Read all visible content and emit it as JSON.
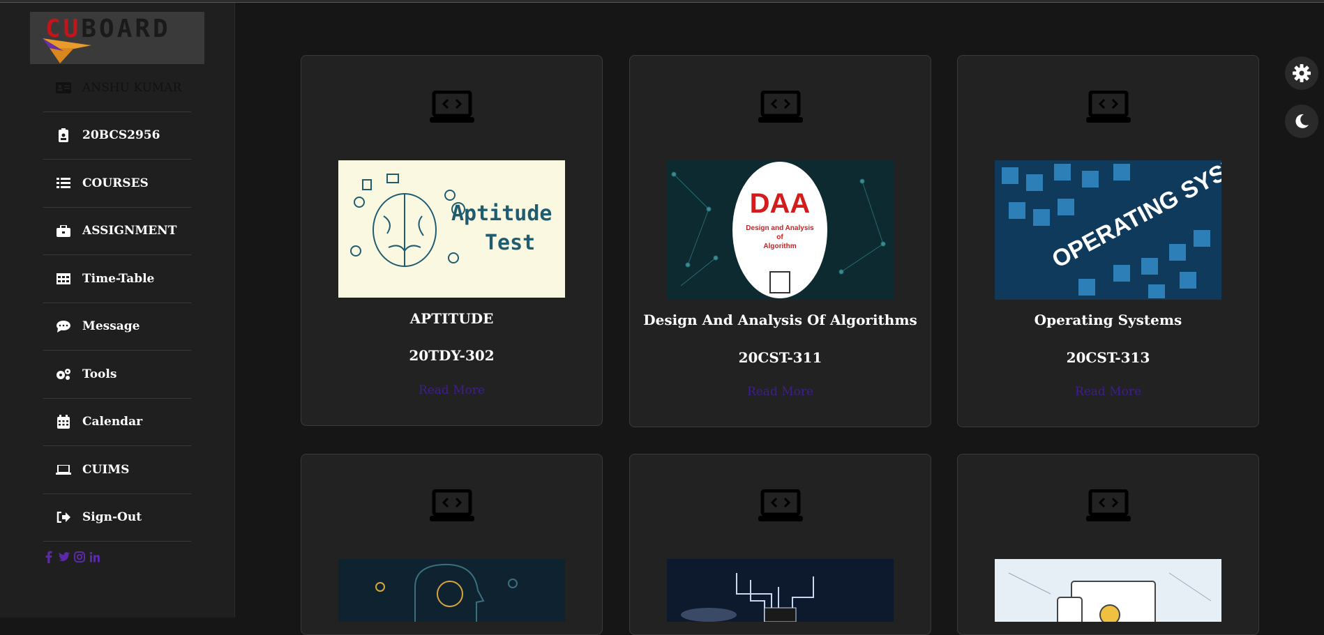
{
  "logo": {
    "text_cu": "CU",
    "text_rest": "BOARD"
  },
  "sidebar": {
    "items": [
      {
        "label": "ANSHU KUMAR",
        "icon": "id-card-icon"
      },
      {
        "label": "20BCS2956",
        "icon": "id-badge-icon"
      },
      {
        "label": "COURSES",
        "icon": "list-icon"
      },
      {
        "label": "ASSIGNMENT",
        "icon": "briefcase-icon"
      },
      {
        "label": "Time-Table",
        "icon": "table-icon"
      },
      {
        "label": "Message",
        "icon": "comment-icon"
      },
      {
        "label": "Tools",
        "icon": "gears-icon"
      },
      {
        "label": "Calendar",
        "icon": "calendar-icon"
      },
      {
        "label": "CUIMS",
        "icon": "laptop-icon"
      },
      {
        "label": "Sign-Out",
        "icon": "sign-out-icon"
      }
    ],
    "social": [
      "facebook-icon",
      "twitter-icon",
      "instagram-icon",
      "linkedin-icon"
    ],
    "accent": "#5b2aa6"
  },
  "courses": [
    {
      "title": "APTITUDE",
      "code": "20TDY-302",
      "more": "Read More",
      "image_text": "Aptitude Test"
    },
    {
      "title": "Design And Analysis Of Algorithms",
      "code": "20CST-311",
      "more": "Read More",
      "image_text": "DAA",
      "image_subtext": "Design and Analysis of Algorithm"
    },
    {
      "title": "Operating Systems",
      "code": "20CST-313",
      "more": "Read More",
      "image_text": "OPERATING SYSTEM"
    },
    {
      "title": "",
      "code": "",
      "more": ""
    },
    {
      "title": "",
      "code": "",
      "more": ""
    },
    {
      "title": "",
      "code": "",
      "more": ""
    }
  ],
  "controls": {
    "settings": "gear-icon",
    "theme": "moon-icon"
  },
  "colors": {
    "background": "#161616",
    "card": "#222222",
    "read_more": "#3e1f8c"
  }
}
